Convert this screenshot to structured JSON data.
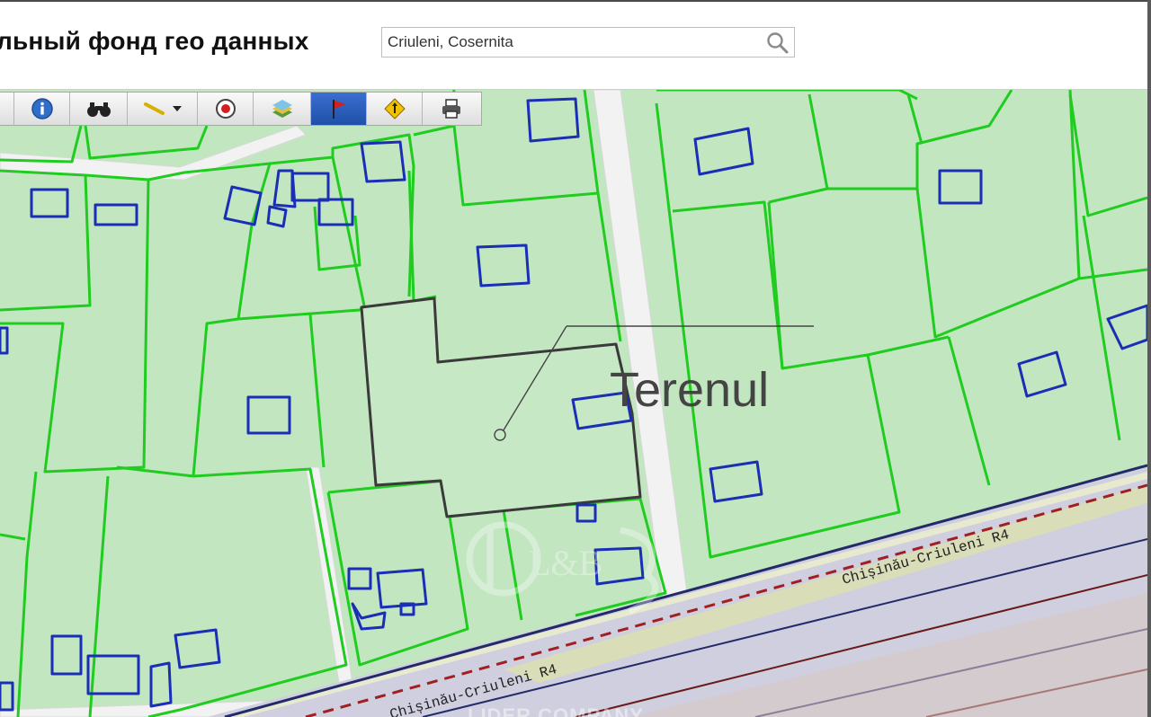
{
  "header": {
    "title": "льный фонд гео данных",
    "search": {
      "value": "Criuleni, Cosernita",
      "placeholder": ""
    }
  },
  "toolbar": {
    "tools": [
      {
        "name": "pan-tool",
        "icon": "hand-icon"
      },
      {
        "name": "info-tool",
        "icon": "info-icon"
      },
      {
        "name": "find-tool",
        "icon": "binoculars-icon"
      },
      {
        "name": "measure-tool",
        "icon": "ruler-icon",
        "has_dropdown": true
      },
      {
        "name": "locate-tool",
        "icon": "target-icon"
      },
      {
        "name": "layers-tool",
        "icon": "layers-icon"
      },
      {
        "name": "flag-tool",
        "icon": "flag-icon",
        "active": true
      },
      {
        "name": "road-sign-tool",
        "icon": "road-sign-icon"
      },
      {
        "name": "print-tool",
        "icon": "printer-icon"
      }
    ]
  },
  "map": {
    "annotation_label": "Terenul",
    "road_labels": [
      "Chișinău-Criuleni R4",
      "Chișinău-Criuleni R4"
    ],
    "watermark_text": "LIDER COMPANY",
    "watermark_monogram": "L&B",
    "colors": {
      "parcel_fill": "#c2e6c0",
      "parcel_border": "#1fcc1f",
      "building_border": "#1a2fb5",
      "selected_border": "#3a3a3a",
      "road_fill": "#cfcfe0",
      "road_edge": "#222a6a",
      "road_dashed": "#a02020",
      "rail_line": "#6a1a1a"
    }
  }
}
